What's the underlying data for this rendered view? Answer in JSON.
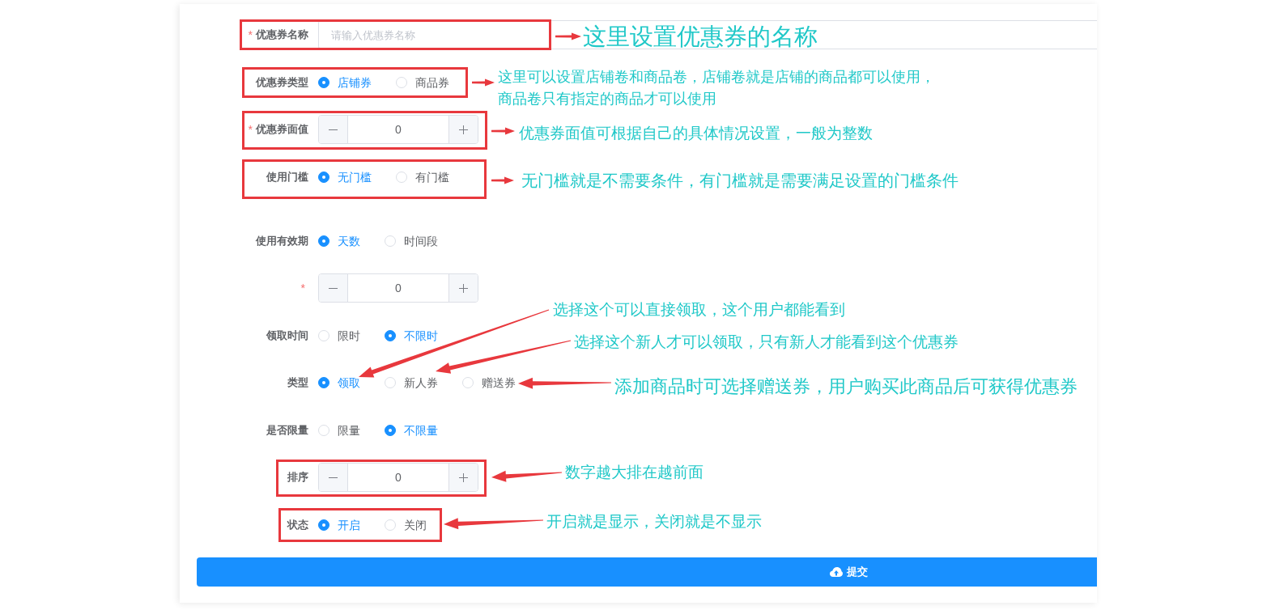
{
  "form": {
    "fields": [
      {
        "kind": "text",
        "required_mark": "*",
        "label": "优惠券名称",
        "placeholder": "请输入优惠券名称"
      },
      {
        "kind": "radio",
        "label": "优惠券类型",
        "options": [
          {
            "label": "店铺券",
            "selected": true
          },
          {
            "label": "商品券",
            "selected": false
          }
        ]
      },
      {
        "kind": "number",
        "required_mark": "*",
        "label": "优惠券面值",
        "value": "0"
      },
      {
        "kind": "radio",
        "label": "使用门槛",
        "options": [
          {
            "label": "无门槛",
            "selected": true
          },
          {
            "label": "有门槛",
            "selected": false
          }
        ]
      },
      {
        "kind": "radio",
        "label": "使用有效期",
        "options": [
          {
            "label": "天数",
            "selected": true
          },
          {
            "label": "时间段",
            "selected": false
          }
        ]
      },
      {
        "kind": "number",
        "required_mark": "*",
        "value": "0"
      },
      {
        "kind": "radio",
        "label": "领取时间",
        "options": [
          {
            "label": "限时",
            "selected": false
          },
          {
            "label": "不限时",
            "selected": true
          }
        ]
      },
      {
        "kind": "radio",
        "label": "类型",
        "options": [
          {
            "label": "领取",
            "selected": true
          },
          {
            "label": "新人券",
            "selected": false
          },
          {
            "label": "赠送券",
            "selected": false
          }
        ]
      },
      {
        "kind": "radio",
        "label": "是否限量",
        "options": [
          {
            "label": "限量",
            "selected": false
          },
          {
            "label": "不限量",
            "selected": true
          }
        ]
      },
      {
        "kind": "number",
        "label": "排序",
        "value": "0"
      },
      {
        "kind": "radio",
        "label": "状态",
        "options": [
          {
            "label": "开启",
            "selected": true
          },
          {
            "label": "关闭",
            "selected": false
          }
        ]
      }
    ],
    "submit": {
      "label": "提交"
    }
  },
  "annotations": [
    {
      "lines": [
        "这里设置优惠券的名称"
      ]
    },
    {
      "lines": [
        "这里可以设置店铺卷和商品卷，店铺卷就是店铺的商品都可以使用，",
        "商品卷只有指定的商品才可以使用"
      ]
    },
    {
      "lines": [
        "优惠券面值可根据自己的具体情况设置，一般为整数"
      ]
    },
    {
      "lines": [
        "无门槛就是不需要条件，有门槛就是需要满足设置的门槛条件"
      ]
    },
    {
      "lines": [
        "选择这个可以直接领取，这个用户都能看到"
      ]
    },
    {
      "lines": [
        "选择这个新人才可以领取，只有新人才能看到这个优惠券"
      ]
    },
    {
      "lines": [
        "添加商品时可选择赠送券，用户购买此商品后可获得优惠券"
      ]
    },
    {
      "lines": [
        "数字越大排在越前面"
      ]
    },
    {
      "lines": [
        "开启就是显示，关闭就是不显示"
      ]
    }
  ]
}
